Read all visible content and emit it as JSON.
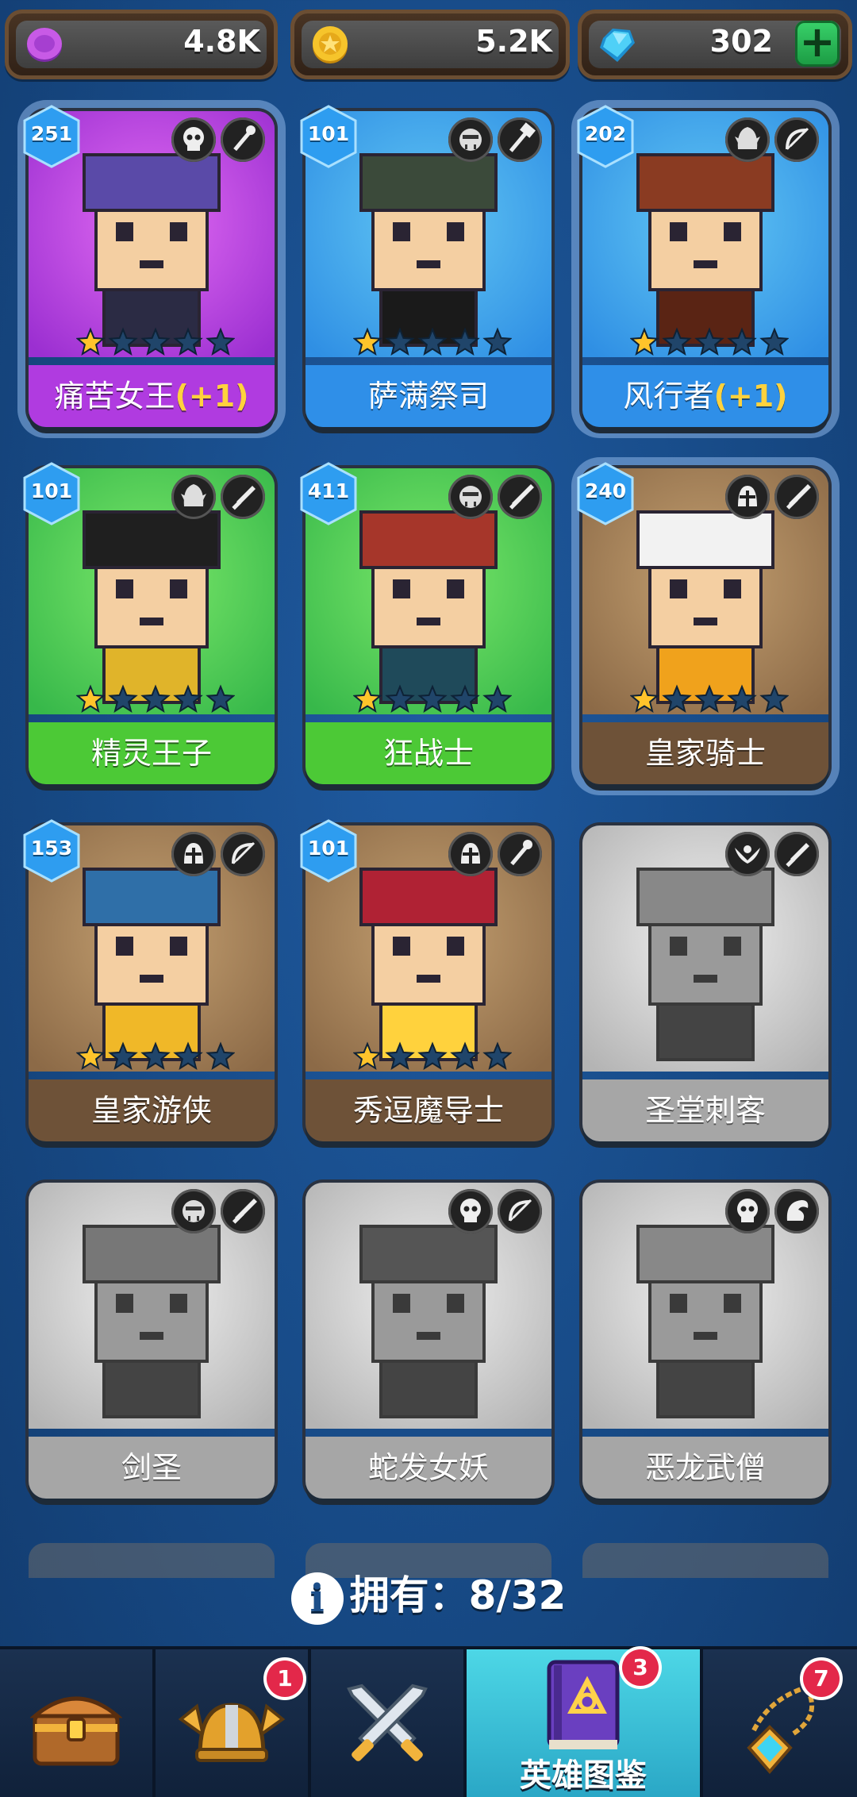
{
  "currencies": [
    {
      "name": "purple-coin",
      "value": "4.8K",
      "color": "#b04ad9"
    },
    {
      "name": "gold-coin",
      "value": "5.2K",
      "color": "#f2b51b"
    },
    {
      "name": "gem",
      "value": "302",
      "color": "#35c3f0"
    }
  ],
  "heroes": [
    {
      "name": "痛苦女王",
      "bonus": "(+1)",
      "level": "251",
      "owned": true,
      "selected": true,
      "bg": "purple",
      "stars": 1,
      "faction": "skull",
      "role": "staff"
    },
    {
      "name": "萨满祭司",
      "bonus": "",
      "level": "101",
      "owned": true,
      "selected": false,
      "bg": "blue",
      "stars": 1,
      "faction": "orc",
      "role": "hammer"
    },
    {
      "name": "风行者",
      "bonus": "(+1)",
      "level": "202",
      "owned": true,
      "selected": true,
      "bg": "blue",
      "stars": 1,
      "faction": "elf",
      "role": "bow"
    },
    {
      "name": "精灵王子",
      "bonus": "",
      "level": "101",
      "owned": true,
      "selected": false,
      "bg": "green",
      "stars": 1,
      "faction": "elf",
      "role": "dagger"
    },
    {
      "name": "狂战士",
      "bonus": "",
      "level": "411",
      "owned": true,
      "selected": false,
      "bg": "green",
      "stars": 1,
      "faction": "orc",
      "role": "sword"
    },
    {
      "name": "皇家骑士",
      "bonus": "",
      "level": "240",
      "owned": true,
      "selected": true,
      "bg": "brown",
      "stars": 1,
      "faction": "helmet",
      "role": "sword"
    },
    {
      "name": "皇家游侠",
      "bonus": "",
      "level": "153",
      "owned": true,
      "selected": false,
      "bg": "brown",
      "stars": 1,
      "faction": "helmet",
      "role": "bow"
    },
    {
      "name": "秀逗魔导士",
      "bonus": "",
      "level": "101",
      "owned": true,
      "selected": false,
      "bg": "brown",
      "stars": 1,
      "faction": "helmet",
      "role": "staff"
    },
    {
      "name": "圣堂刺客",
      "bonus": "",
      "level": "",
      "owned": false,
      "selected": false,
      "bg": "gray",
      "stars": 0,
      "faction": "wings",
      "role": "dagger"
    },
    {
      "name": "剑圣",
      "bonus": "",
      "level": "",
      "owned": false,
      "selected": false,
      "bg": "gray",
      "stars": 0,
      "faction": "orc",
      "role": "sword"
    },
    {
      "name": "蛇发女妖",
      "bonus": "",
      "level": "",
      "owned": false,
      "selected": false,
      "bg": "gray",
      "stars": 0,
      "faction": "skull",
      "role": "bow"
    },
    {
      "name": "恶龙武僧",
      "bonus": "",
      "level": "",
      "owned": false,
      "selected": false,
      "bg": "gray",
      "stars": 0,
      "faction": "skull",
      "role": "dragon"
    }
  ],
  "owned_label": "拥有：",
  "owned_count": "8/32",
  "nav": [
    {
      "name": "chest",
      "badge": "",
      "label": ""
    },
    {
      "name": "helmet",
      "badge": "1",
      "label": ""
    },
    {
      "name": "battle",
      "badge": "",
      "label": ""
    },
    {
      "name": "hero-book",
      "badge": "3",
      "label": "英雄图鉴",
      "active": true
    },
    {
      "name": "amulet",
      "badge": "7",
      "label": ""
    }
  ]
}
